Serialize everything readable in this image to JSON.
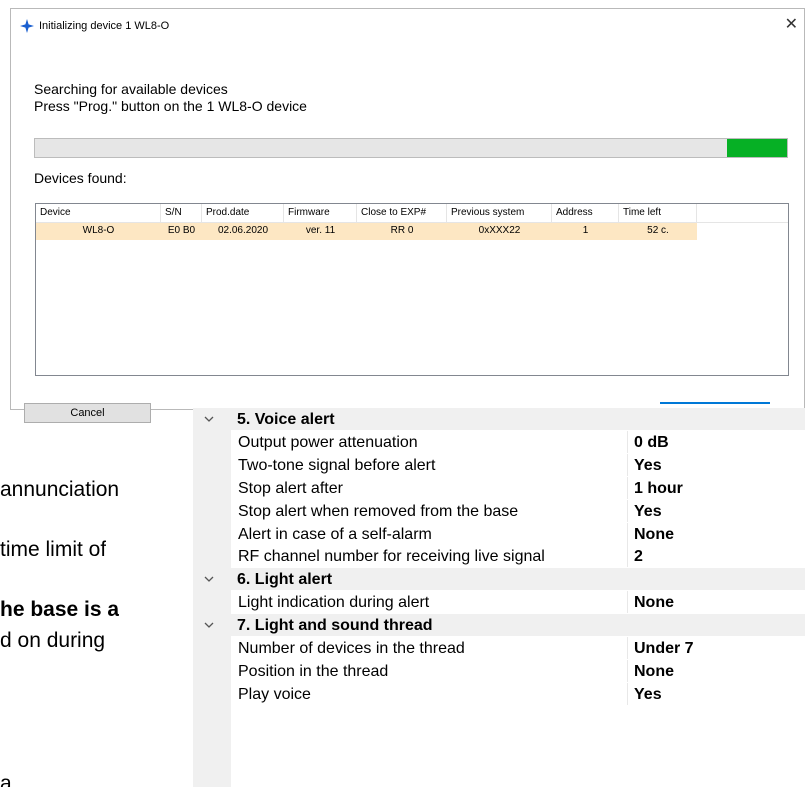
{
  "document": {
    "lines": [
      "annunciation",
      "time limit of",
      "he base is a",
      "d on during",
      "a   "
    ]
  },
  "dialog": {
    "title": "Initializing device 1 WL8-O",
    "icon": "star-app-icon",
    "accent_color": "#0078d7",
    "message_line1": "Searching for available devices",
    "message_line2": "Press \"Prog.\" button on the 1 WL8-O device",
    "progress_percent": 8,
    "progress_color": "#06b025",
    "devices_found_label": "Devices found:",
    "table": {
      "columns": [
        "Device",
        "S/N",
        "Prod.date",
        "Firmware",
        "Close to EXP#",
        "Previous system",
        "Address",
        "Time left"
      ],
      "rows": [
        [
          "WL8-O",
          "E0 B0",
          "02.06.2020",
          "ver. 11",
          "RR 0",
          "0xXXX22",
          "1",
          "52 c."
        ]
      ],
      "selected_row_color": "#fde7c3"
    },
    "cancel_label": "Cancel"
  },
  "properties": {
    "categories": [
      {
        "title": "5. Voice alert",
        "items": [
          {
            "name": "Output power attenuation",
            "value": "0 dB"
          },
          {
            "name": "Two-tone signal before alert",
            "value": "Yes"
          },
          {
            "name": "Stop alert after",
            "value": "1 hour"
          },
          {
            "name": "Stop alert when removed from the base",
            "value": "Yes"
          },
          {
            "name": "Alert in case of a self-alarm",
            "value": "None"
          },
          {
            "name": "RF channel number for receiving live signal",
            "value": "2"
          }
        ]
      },
      {
        "title": "6. Light alert",
        "items": [
          {
            "name": "Light indication during alert",
            "value": "None"
          }
        ]
      },
      {
        "title": "7. Light and sound thread",
        "items": [
          {
            "name": "Number of devices in the thread",
            "value": "Under 7"
          },
          {
            "name": "Position in the thread",
            "value": "None"
          },
          {
            "name": "Play voice",
            "value": "Yes"
          }
        ]
      }
    ]
  }
}
